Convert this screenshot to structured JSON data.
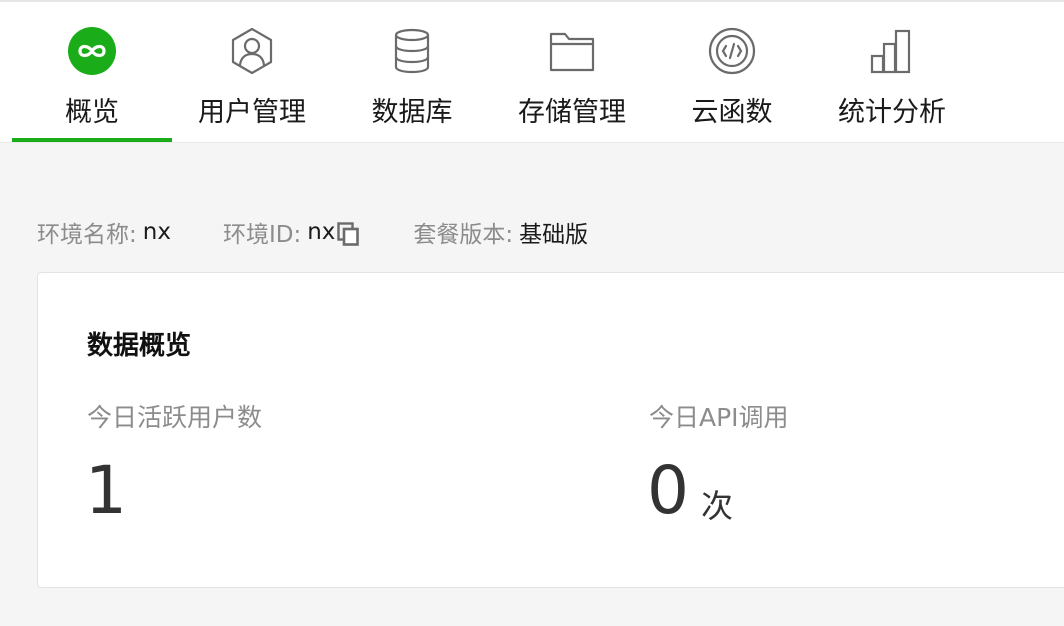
{
  "tabs": [
    {
      "label": "概览",
      "icon": "infinity-icon",
      "active": true
    },
    {
      "label": "用户管理",
      "icon": "user-icon",
      "active": false
    },
    {
      "label": "数据库",
      "icon": "database-icon",
      "active": false
    },
    {
      "label": "存储管理",
      "icon": "folder-icon",
      "active": false
    },
    {
      "label": "云函数",
      "icon": "code-icon",
      "active": false
    },
    {
      "label": "统计分析",
      "icon": "bar-chart-icon",
      "active": false
    }
  ],
  "env": {
    "name_label": "环境名称:",
    "name_value": "nx",
    "id_label": "环境ID:",
    "id_value": "nx",
    "plan_label": "套餐版本:",
    "plan_value": "基础版"
  },
  "overview": {
    "title": "数据概览",
    "dau_label": "今日活跃用户数",
    "dau_value": "1",
    "api_label": "今日API调用",
    "api_value": "0",
    "api_unit": "次"
  },
  "colors": {
    "accent": "#1aad19",
    "icon_gray": "#6b6b6b",
    "page_bg": "#f5f5f5"
  }
}
